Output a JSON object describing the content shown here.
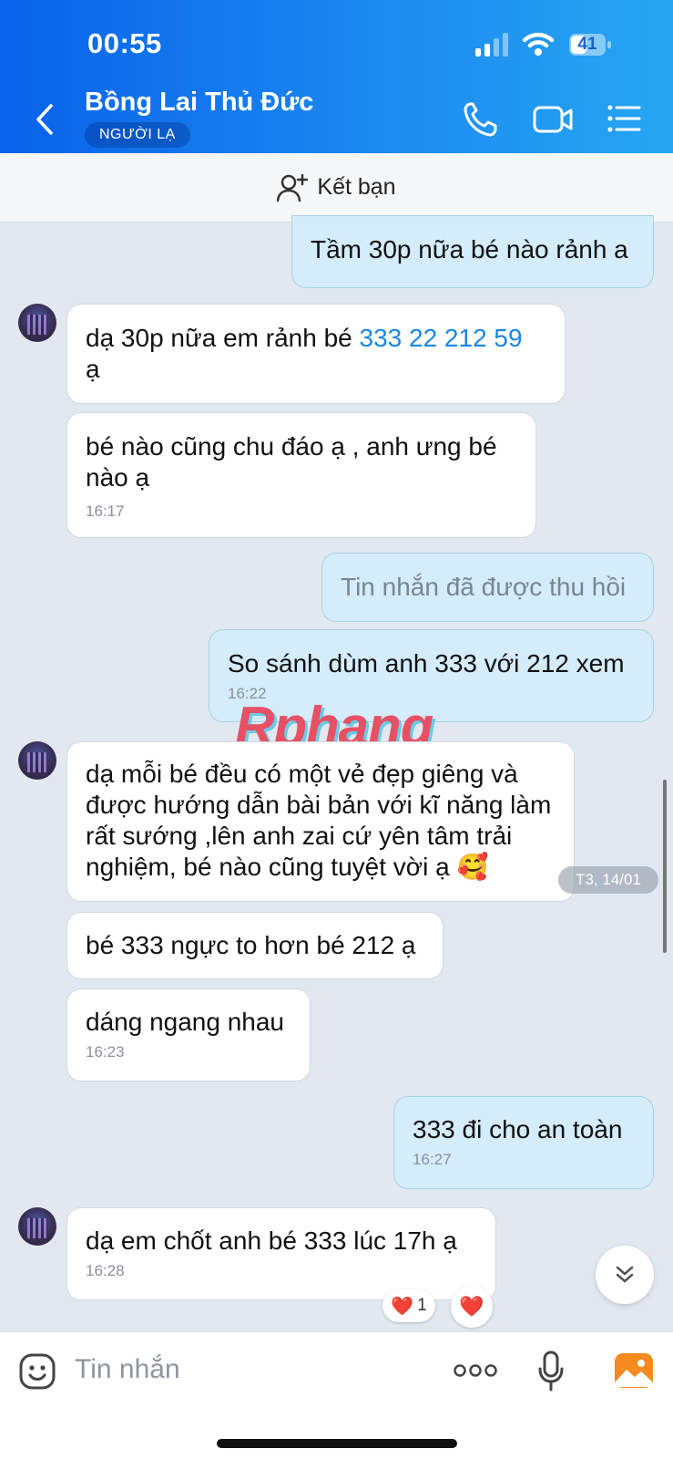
{
  "status": {
    "time": "00:55",
    "battery": "41"
  },
  "header": {
    "title": "Bồng Lai Thủ Đức",
    "tag": "NGƯỜI LẠ",
    "back_icon": "chevron-left-icon",
    "call_icon": "phone-icon",
    "video_icon": "video-camera-icon",
    "menu_icon": "list-menu-icon"
  },
  "friend_bar": {
    "label": "Kết bạn",
    "icon": "add-user-icon"
  },
  "messages": [
    {
      "side": "sent",
      "text": "Tầm 30p nữa bé nào rảnh a",
      "time": ""
    },
    {
      "side": "recv",
      "text_pre": "dạ 30p nữa em rảnh bé ",
      "link": "333 22 212 59",
      "text_post": "ạ",
      "time": ""
    },
    {
      "side": "recv",
      "text": "bé nào cũng chu đáo ạ , anh ưng bé nào ạ",
      "time": "16:17"
    },
    {
      "side": "sent",
      "text": "Tin nhắn đã được thu hồi",
      "time": "",
      "recalled": true
    },
    {
      "side": "sent",
      "text": "So sánh dùm anh 333 với 212 xem",
      "time": "16:22"
    },
    {
      "side": "recv",
      "text": "dạ mỗi bé đều có một vẻ đẹp giêng và được hướng dẫn bài bản với kĩ năng làm rất sướng ,lên anh zai cứ yên tâm trải nghiệm, bé nào cũng tuyệt vời ạ 🥰",
      "time": ""
    },
    {
      "side": "recv",
      "text": "bé 333 ngực to hơn bé 212 ạ",
      "time": ""
    },
    {
      "side": "recv",
      "text": "dáng ngang nhau",
      "time": "16:23"
    },
    {
      "side": "sent",
      "text": "333 đi cho an toàn",
      "time": "16:27"
    },
    {
      "side": "recv",
      "text": "dạ em chốt anh bé 333  lúc 17h ạ",
      "time": "16:28"
    }
  ],
  "date_chip": "T3, 14/01",
  "watermark": "Rphang",
  "reaction": {
    "emoji": "❤️",
    "count": "1"
  },
  "react_button_emoji": "❤️",
  "composer": {
    "placeholder": "Tin nhắn",
    "emoji_icon": "sticker-face-icon",
    "more_icon": "more-dots-icon",
    "mic_icon": "microphone-icon",
    "image_icon": "image-gallery-icon"
  },
  "colors": {
    "header_start": "#0862ea",
    "header_end": "#26a6f2",
    "sent_bubble": "#d4ecfb",
    "received_bubble": "#ffffff",
    "link": "#1a86e8",
    "chat_bg": "#e2e8f0"
  }
}
